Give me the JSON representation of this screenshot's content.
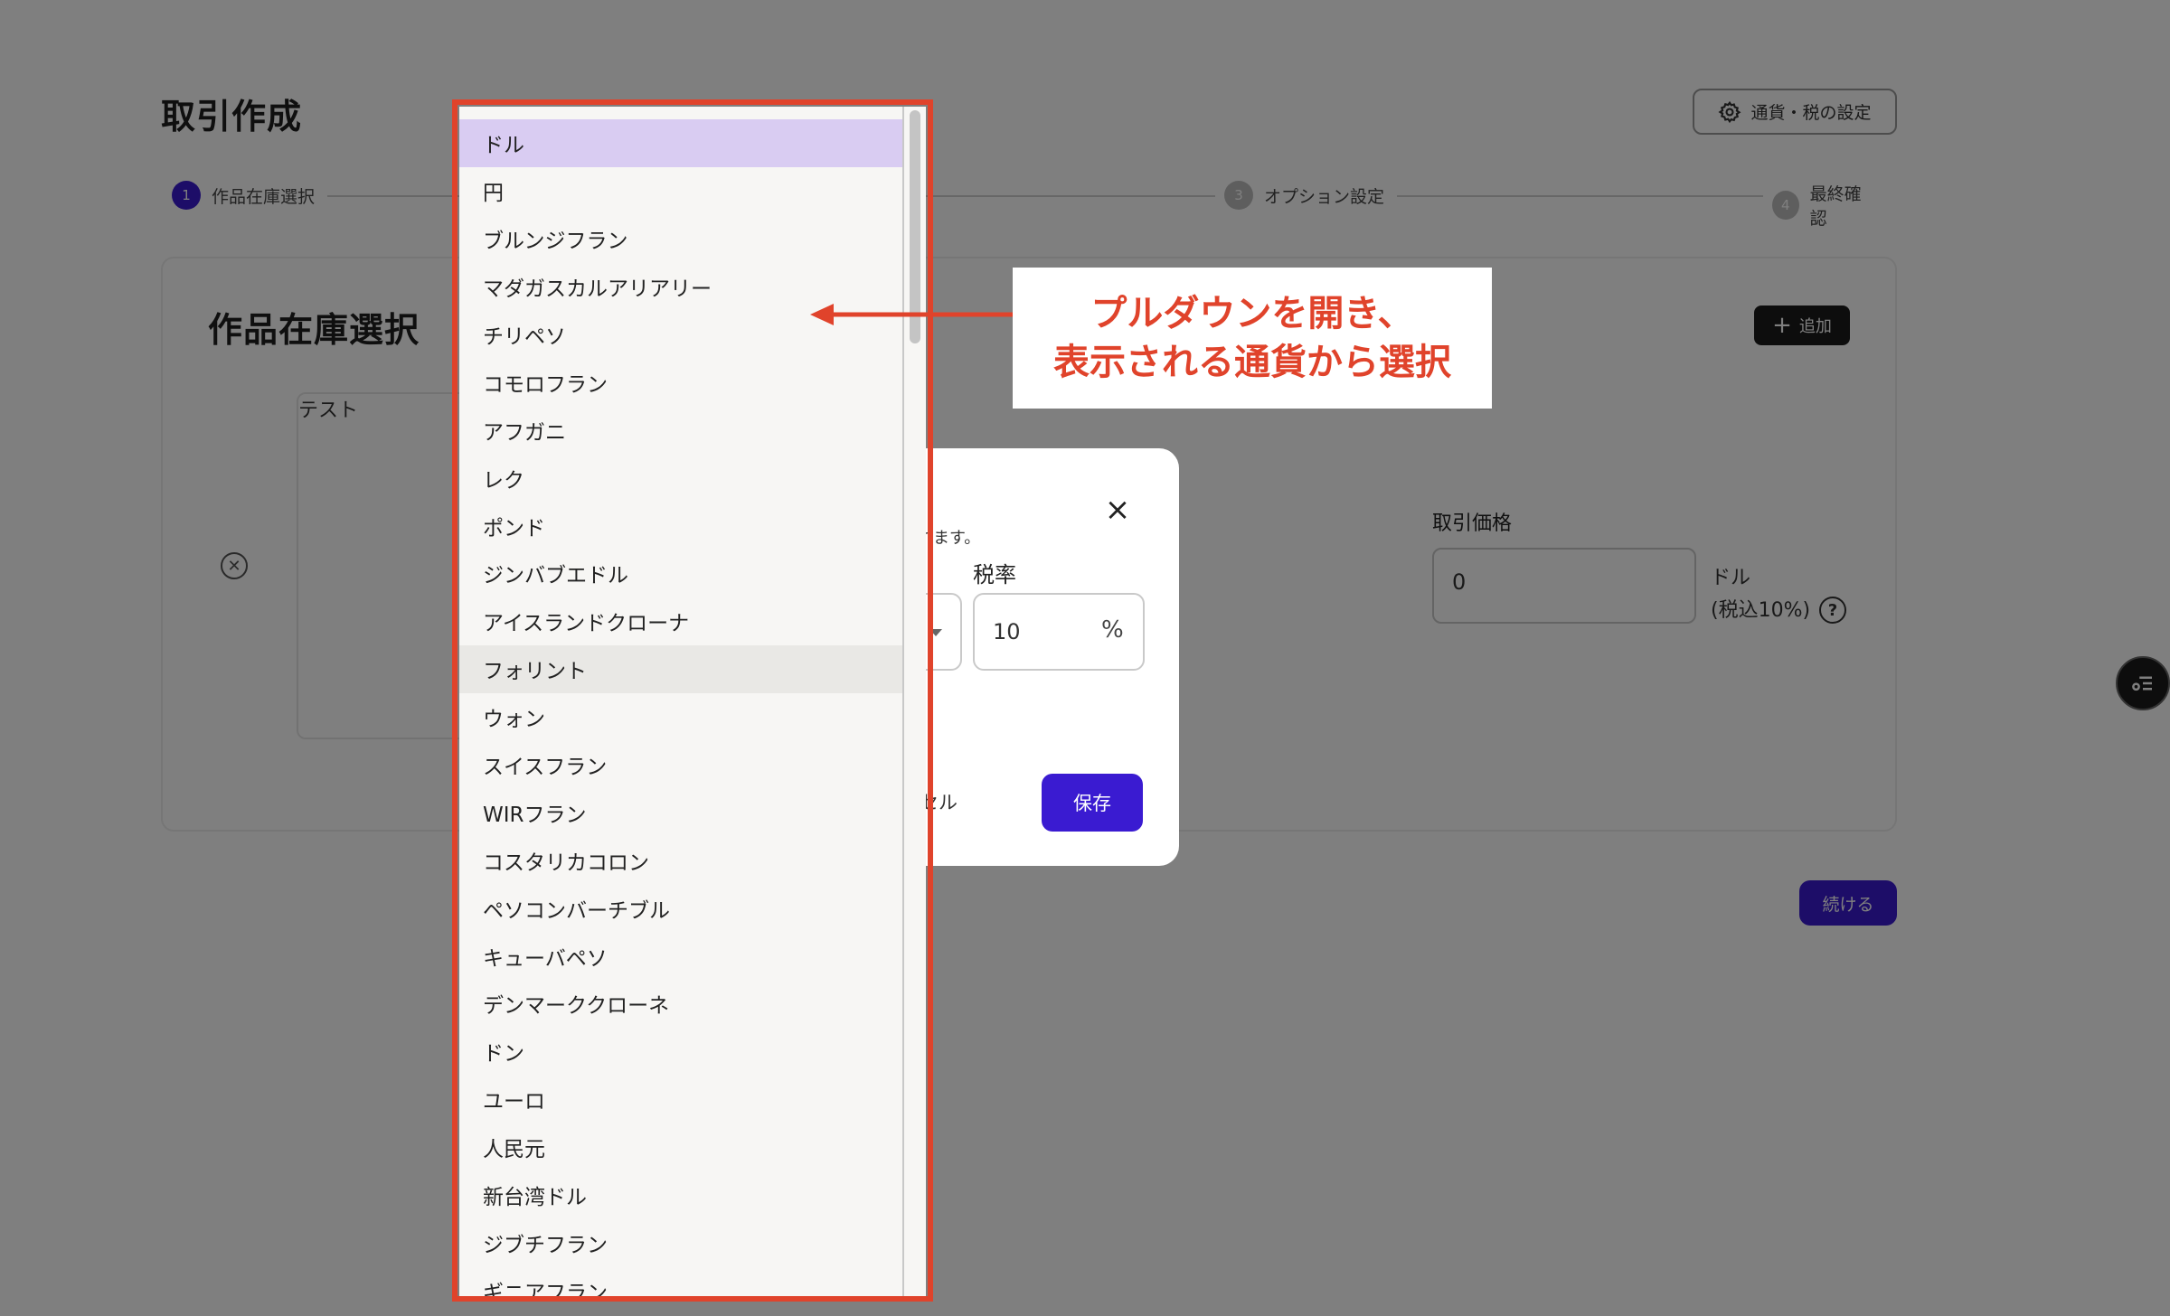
{
  "page": {
    "title": "取引作成",
    "settings_button_label": "通貨・税の設定",
    "steps": [
      {
        "number": "1",
        "label": "作品在庫選択"
      },
      {
        "number": "3",
        "label": "オプション設定"
      },
      {
        "number": "4",
        "label": "最終確認"
      }
    ],
    "card_title": "作品在庫選択",
    "add_button_label": "追加",
    "image_alt": "テスト",
    "price_label": "取引価格",
    "price_value": "0",
    "price_unit_line1": "ドル",
    "price_unit_line2": "(税込10%)",
    "help_icon": "?",
    "continue_button_label": "続ける"
  },
  "modal": {
    "hint_text": "されます。",
    "tax_label": "税率",
    "tax_value": "10",
    "tax_unit": "%",
    "cancel_label": "ンセル",
    "save_label": "保存"
  },
  "dropdown": {
    "selected": "ドル",
    "hovered": "フォリント",
    "options": [
      "ドル",
      "円",
      "ブルンジフラン",
      "マダガスカルアリアリー",
      "チリペソ",
      "コモロフラン",
      "アフガニ",
      "レク",
      "ポンド",
      "ジンバブエドル",
      "アイスランドクローナ",
      "フォリント",
      "ウォン",
      "スイスフラン",
      "WIRフラン",
      "コスタリカコロン",
      "ペソコンバーチブル",
      "キューバペソ",
      "デンマーククローネ",
      "ドン",
      "ユーロ",
      "人民元",
      "新台湾ドル",
      "ジブチフラン",
      "ギニアフラン"
    ]
  },
  "annotation": {
    "line1": "プルダウンを開き、",
    "line2": "表示される通貨から選択",
    "color": "#e0432b"
  },
  "colors": {
    "primary": "#3a1bd1",
    "selected_option_bg": "#d9ccf2"
  }
}
